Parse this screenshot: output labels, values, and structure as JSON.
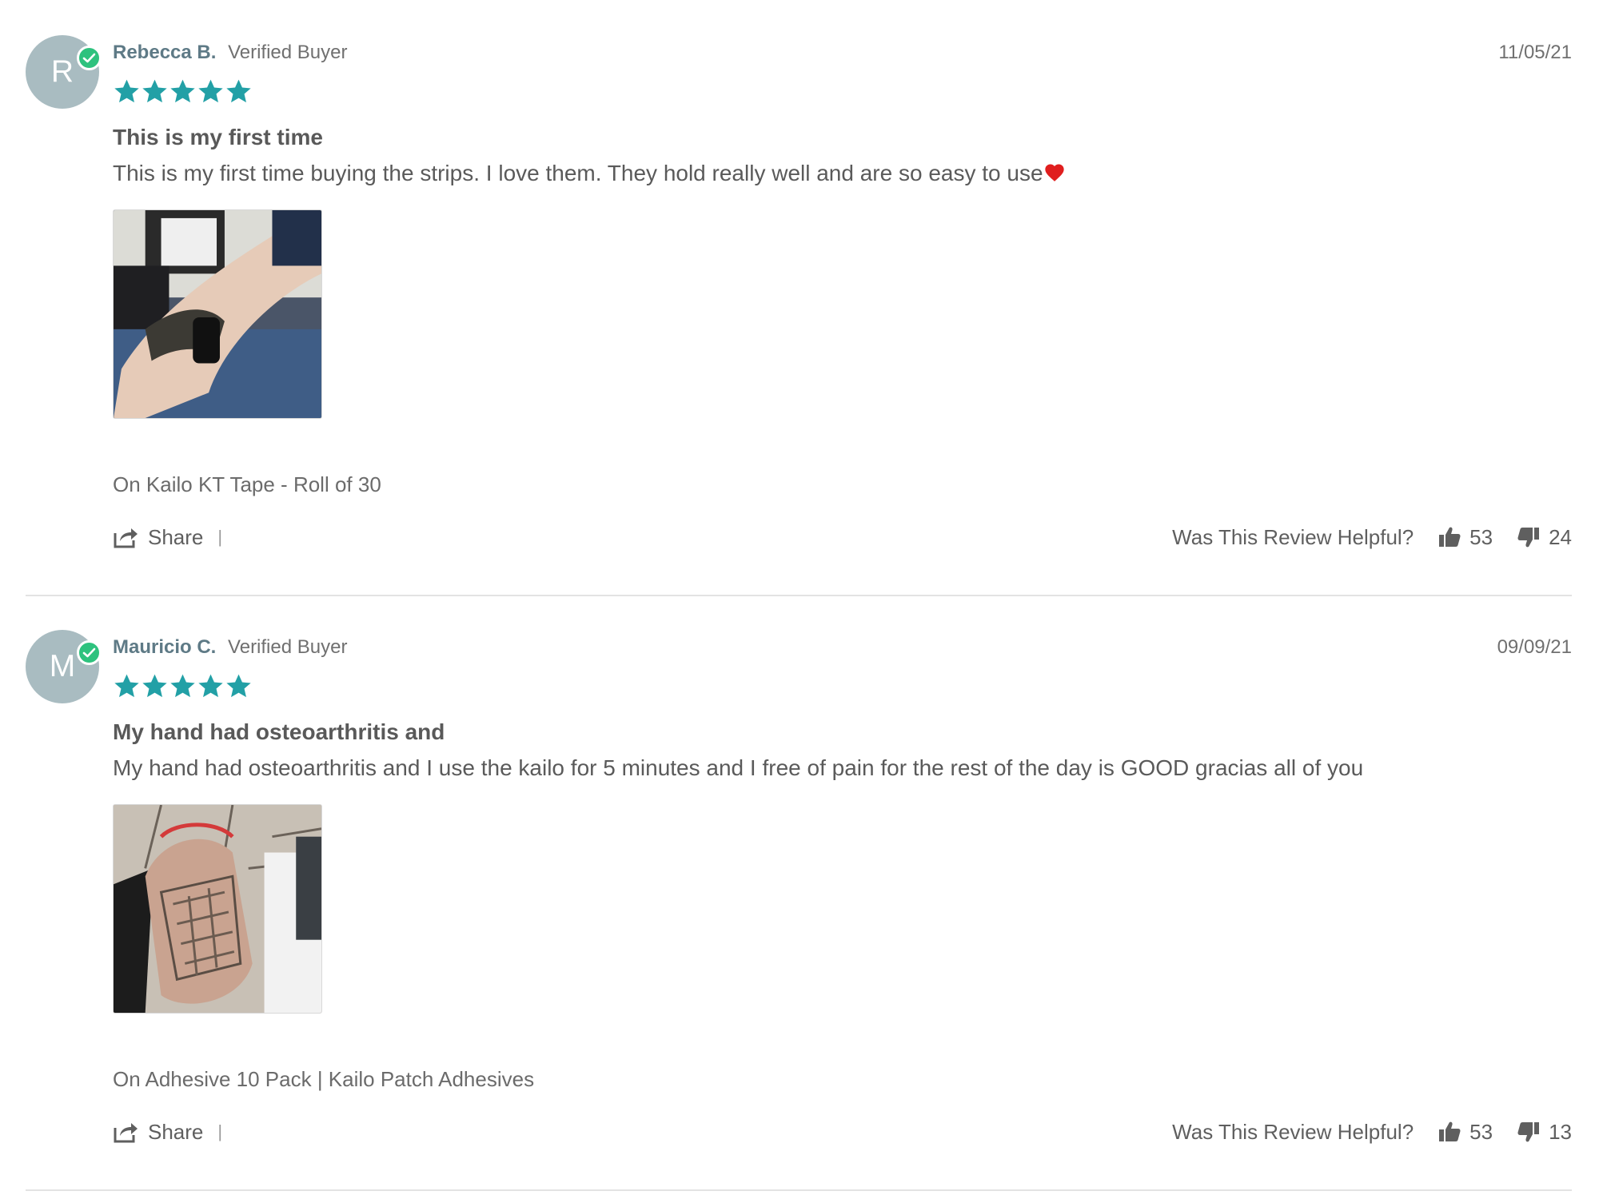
{
  "reviews": [
    {
      "initial": "R",
      "name": "Rebecca B.",
      "verified_label": "Verified Buyer",
      "date": "11/05/21",
      "rating": 5,
      "title": "This is my first time",
      "body": "This is my first time buying the strips. I love them. They hold really well and are so easy to use",
      "body_suffix_icon": "heart-icon",
      "product": "On Kailo KT Tape - Roll of 30",
      "share_label": "Share",
      "share_divider": "|",
      "helpful_label": "Was This Review Helpful?",
      "helpful_up": "53",
      "helpful_down": "24"
    },
    {
      "initial": "M",
      "name": "Mauricio C.",
      "verified_label": "Verified Buyer",
      "date": "09/09/21",
      "rating": 5,
      "title": "My hand had osteoarthritis and",
      "body": "My hand had osteoarthritis and I use the kailo for 5 minutes and I free of pain for the rest of the day is GOOD gracias all of you",
      "product": "On Adhesive 10 Pack | Kailo Patch Adhesives",
      "share_label": "Share",
      "share_divider": "|",
      "helpful_label": "Was This Review Helpful?",
      "helpful_up": "53",
      "helpful_down": "13"
    }
  ],
  "colors": {
    "star": "#22a0a6",
    "avatar": "#a9bcc1",
    "verified_badge": "#2ec27e",
    "name": "#5e7a86"
  },
  "icons": {
    "share": "share-icon",
    "thumbs_up": "thumbs-up-icon",
    "thumbs_down": "thumbs-down-icon",
    "star": "star-icon",
    "verified": "verified-check-icon"
  }
}
